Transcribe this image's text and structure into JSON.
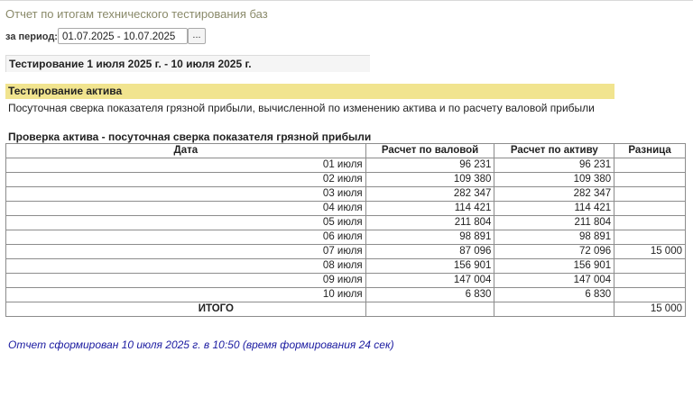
{
  "page": {
    "title": "Отчет по итогам технического тестирования баз"
  },
  "period": {
    "label": "за период:",
    "value": "01.07.2025 - 10.07.2025",
    "button": "..."
  },
  "report": {
    "header": "Тестирование 1 июля 2025 г. - 10 июля 2025 г.",
    "section_title": "Тестирование актива",
    "section_description": "Посуточная сверка показателя грязной прибыли, вычисленной по изменению актива и по расчету валовой прибыли",
    "table_title": "Проверка актива - посуточная сверка показателя грязной прибыли",
    "columns": [
      "Дата",
      "Расчет по валовой",
      "Расчет по активу",
      "Разница"
    ],
    "rows": [
      {
        "date": "01 июля",
        "gross": "96 231",
        "asset": "96 231",
        "diff": ""
      },
      {
        "date": "02 июля",
        "gross": "109 380",
        "asset": "109 380",
        "diff": ""
      },
      {
        "date": "03 июля",
        "gross": "282 347",
        "asset": "282 347",
        "diff": ""
      },
      {
        "date": "04 июля",
        "gross": "114 421",
        "asset": "114 421",
        "diff": ""
      },
      {
        "date": "05 июля",
        "gross": "211 804",
        "asset": "211 804",
        "diff": ""
      },
      {
        "date": "06 июля",
        "gross": "98 891",
        "asset": "98 891",
        "diff": ""
      },
      {
        "date": "07 июля",
        "gross": "87 096",
        "asset": "72 096",
        "diff": "15 000"
      },
      {
        "date": "08 июля",
        "gross": "156 901",
        "asset": "156 901",
        "diff": ""
      },
      {
        "date": "09 июля",
        "gross": "147 004",
        "asset": "147 004",
        "diff": ""
      },
      {
        "date": "10 июля",
        "gross": "6 830",
        "asset": "6 830",
        "diff": ""
      }
    ],
    "total": {
      "label": "ИТОГО",
      "gross": "",
      "asset": "",
      "diff": "15 000"
    },
    "footer": "Отчет сформирован 10 июля 2025 г. в 10:50 (время формирования 24 сек)"
  }
}
